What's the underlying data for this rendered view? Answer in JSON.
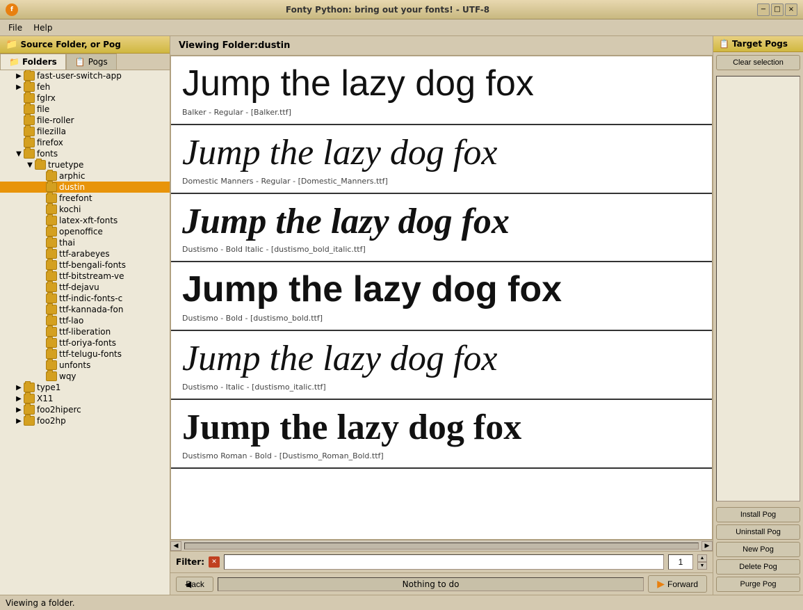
{
  "titlebar": {
    "title": "Fonty Python: bring out your fonts!   -   UTF-8",
    "minimize": "−",
    "maximize": "□",
    "close": "×"
  },
  "menu": {
    "file": "File",
    "help": "Help"
  },
  "left_panel": {
    "header": "Source Folder, or Pog",
    "tab_folders": "Folders",
    "tab_pogs": "Pogs",
    "tree_items": [
      {
        "level": 1,
        "indent": 20,
        "label": "fast-user-switch-app",
        "has_arrow": true,
        "selected": false
      },
      {
        "level": 1,
        "indent": 20,
        "label": "feh",
        "has_arrow": true,
        "selected": false
      },
      {
        "level": 1,
        "indent": 20,
        "label": "fglrx",
        "has_arrow": false,
        "selected": false
      },
      {
        "level": 1,
        "indent": 20,
        "label": "file",
        "has_arrow": false,
        "selected": false
      },
      {
        "level": 1,
        "indent": 20,
        "label": "file-roller",
        "has_arrow": false,
        "selected": false
      },
      {
        "level": 1,
        "indent": 20,
        "label": "filezilla",
        "has_arrow": false,
        "selected": false
      },
      {
        "level": 1,
        "indent": 20,
        "label": "firefox",
        "has_arrow": false,
        "selected": false
      },
      {
        "level": 1,
        "indent": 20,
        "label": "fonts",
        "has_arrow": true,
        "open": true,
        "selected": false
      },
      {
        "level": 2,
        "indent": 36,
        "label": "truetype",
        "has_arrow": true,
        "open": true,
        "selected": false
      },
      {
        "level": 3,
        "indent": 52,
        "label": "arphic",
        "has_arrow": false,
        "selected": false
      },
      {
        "level": 3,
        "indent": 52,
        "label": "dustin",
        "has_arrow": false,
        "selected": true
      },
      {
        "level": 3,
        "indent": 52,
        "label": "freefont",
        "has_arrow": false,
        "selected": false
      },
      {
        "level": 3,
        "indent": 52,
        "label": "kochi",
        "has_arrow": false,
        "selected": false
      },
      {
        "level": 3,
        "indent": 52,
        "label": "latex-xft-fonts",
        "has_arrow": false,
        "selected": false
      },
      {
        "level": 3,
        "indent": 52,
        "label": "openoffice",
        "has_arrow": false,
        "selected": false
      },
      {
        "level": 3,
        "indent": 52,
        "label": "thai",
        "has_arrow": false,
        "selected": false
      },
      {
        "level": 3,
        "indent": 52,
        "label": "ttf-arabeyes",
        "has_arrow": false,
        "selected": false
      },
      {
        "level": 3,
        "indent": 52,
        "label": "ttf-bengali-fonts",
        "has_arrow": false,
        "selected": false
      },
      {
        "level": 3,
        "indent": 52,
        "label": "ttf-bitstream-ve",
        "has_arrow": false,
        "selected": false
      },
      {
        "level": 3,
        "indent": 52,
        "label": "ttf-dejavu",
        "has_arrow": false,
        "selected": false
      },
      {
        "level": 3,
        "indent": 52,
        "label": "ttf-indic-fonts-c",
        "has_arrow": false,
        "selected": false
      },
      {
        "level": 3,
        "indent": 52,
        "label": "ttf-kannada-fon",
        "has_arrow": false,
        "selected": false
      },
      {
        "level": 3,
        "indent": 52,
        "label": "ttf-lao",
        "has_arrow": false,
        "selected": false
      },
      {
        "level": 3,
        "indent": 52,
        "label": "ttf-liberation",
        "has_arrow": false,
        "selected": false
      },
      {
        "level": 3,
        "indent": 52,
        "label": "ttf-oriya-fonts",
        "has_arrow": false,
        "selected": false
      },
      {
        "level": 3,
        "indent": 52,
        "label": "ttf-telugu-fonts",
        "has_arrow": false,
        "selected": false
      },
      {
        "level": 3,
        "indent": 52,
        "label": "unfonts",
        "has_arrow": false,
        "selected": false
      },
      {
        "level": 3,
        "indent": 52,
        "label": "wqy",
        "has_arrow": false,
        "selected": false
      },
      {
        "level": 1,
        "indent": 20,
        "label": "type1",
        "has_arrow": true,
        "selected": false
      },
      {
        "level": 1,
        "indent": 20,
        "label": "X11",
        "has_arrow": true,
        "selected": false
      },
      {
        "level": 1,
        "indent": 20,
        "label": "foo2hiperc",
        "has_arrow": true,
        "selected": false
      },
      {
        "level": 1,
        "indent": 20,
        "label": "foo2hp",
        "has_arrow": true,
        "selected": false
      }
    ]
  },
  "center_panel": {
    "viewing_label": "Viewing Folder:dustin",
    "font_cards": [
      {
        "preview_text": "Jump the lazy dog fox",
        "label": "Balker - Regular - [Balker.ttf]",
        "style": "normal",
        "font_family": "sans-serif"
      },
      {
        "preview_text": "Jump the lazy dog fox",
        "label": "Domestic Manners - Regular - [Domestic_Manners.ttf]",
        "style": "italic",
        "font_family": "cursive"
      },
      {
        "preview_text": "Jump the lazy dog fox",
        "label": "Dustismo -  Bold Italic - [dustismo_bold_italic.ttf]",
        "style": "bold-italic",
        "font_family": "cursive"
      },
      {
        "preview_text": "Jump the lazy dog fox",
        "label": "Dustismo -  Bold - [dustismo_bold.ttf]",
        "style": "bold",
        "font_family": "sans-serif"
      },
      {
        "preview_text": "Jump the lazy dog fox",
        "label": "Dustismo -  Italic - [dustismo_italic.ttf]",
        "style": "italic",
        "font_family": "cursive"
      },
      {
        "preview_text": "Jump the lazy dog fox",
        "label": "Dustismo Roman - Bold - [Dustismo_Roman_Bold.ttf]",
        "style": "bold",
        "font_family": "Georgia, serif"
      }
    ],
    "filter_label": "Filter:",
    "filter_placeholder": "",
    "page_number": "1",
    "back_label": "◀  Back",
    "forward_label": "Forward",
    "status_text": "Nothing to do"
  },
  "right_panel": {
    "header": "Target Pogs",
    "clear_selection": "Clear selection",
    "install_pog": "Install Pog",
    "uninstall_pog": "Uninstall Pog",
    "new_pog": "New Pog",
    "delete_pog": "Delete Pog",
    "purge_pog": "Purge Pog"
  },
  "statusbar": {
    "text": "Viewing a folder."
  }
}
